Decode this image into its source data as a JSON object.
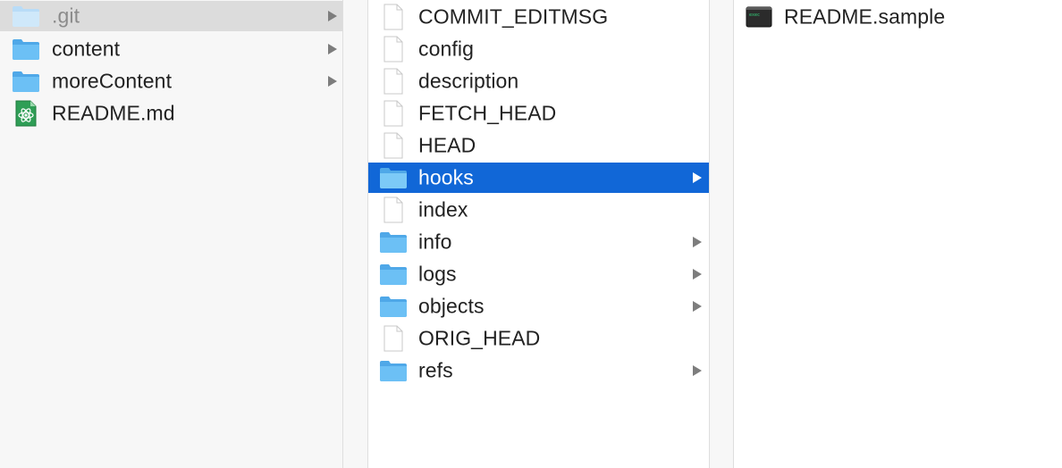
{
  "columns": [
    {
      "items": [
        {
          "name": ".git",
          "type": "folder",
          "has_children": true,
          "state": "dimmed"
        },
        {
          "name": "content",
          "type": "folder",
          "has_children": true,
          "state": "normal"
        },
        {
          "name": "moreContent",
          "type": "folder",
          "has_children": true,
          "state": "normal"
        },
        {
          "name": "README.md",
          "type": "atom-file",
          "has_children": false,
          "state": "normal"
        }
      ]
    },
    {
      "items": [
        {
          "name": "COMMIT_EDITMSG",
          "type": "document",
          "has_children": false,
          "state": "normal"
        },
        {
          "name": "config",
          "type": "document",
          "has_children": false,
          "state": "normal"
        },
        {
          "name": "description",
          "type": "document",
          "has_children": false,
          "state": "normal"
        },
        {
          "name": "FETCH_HEAD",
          "type": "document",
          "has_children": false,
          "state": "normal"
        },
        {
          "name": "HEAD",
          "type": "document",
          "has_children": false,
          "state": "normal"
        },
        {
          "name": "hooks",
          "type": "folder",
          "has_children": true,
          "state": "selected"
        },
        {
          "name": "index",
          "type": "document",
          "has_children": false,
          "state": "normal"
        },
        {
          "name": "info",
          "type": "folder",
          "has_children": true,
          "state": "normal"
        },
        {
          "name": "logs",
          "type": "folder",
          "has_children": true,
          "state": "normal"
        },
        {
          "name": "objects",
          "type": "folder",
          "has_children": true,
          "state": "normal"
        },
        {
          "name": "ORIG_HEAD",
          "type": "document",
          "has_children": false,
          "state": "normal"
        },
        {
          "name": "refs",
          "type": "folder",
          "has_children": true,
          "state": "normal"
        }
      ]
    },
    {
      "items": [
        {
          "name": "README.sample",
          "type": "executable",
          "has_children": false,
          "state": "normal"
        }
      ]
    }
  ],
  "colors": {
    "selection": "#1167d7",
    "folder": "#6cc0f5",
    "dimmed_row": "#dcdcdc"
  },
  "icons": {
    "folder": "folder-icon",
    "document": "document-icon",
    "atom-file": "atom-file-icon",
    "executable": "terminal-executable-icon",
    "chevron": "chevron-right-icon"
  }
}
